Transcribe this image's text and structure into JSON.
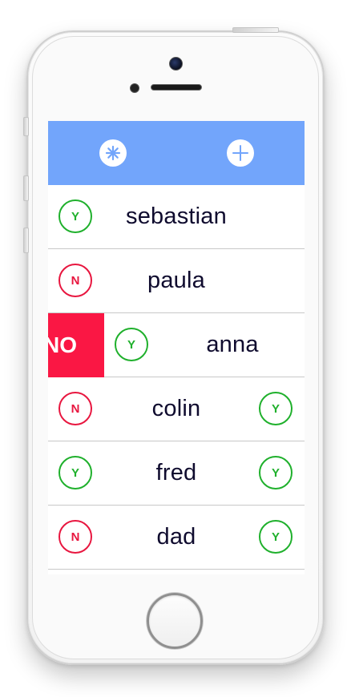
{
  "app": {
    "toolbar": {
      "settings_icon": "asterisk-icon",
      "add_icon": "plus-icon",
      "accent": "#72a5fb"
    },
    "people": [
      {
        "name": "sebastian",
        "left": "Y",
        "right": null,
        "swiped": false
      },
      {
        "name": "paula",
        "left": "N",
        "right": null,
        "swiped": false
      },
      {
        "name": "anna",
        "left": "Y",
        "right": null,
        "swiped": true,
        "action_label": "NO"
      },
      {
        "name": "colin",
        "left": "N",
        "right": "Y",
        "swiped": false
      },
      {
        "name": "fred",
        "left": "Y",
        "right": "Y",
        "swiped": false
      },
      {
        "name": "dad",
        "left": "N",
        "right": "Y",
        "swiped": false
      }
    ],
    "colors": {
      "yes": "#1fb02c",
      "no": "#e8163f",
      "swipe_action": "#fa1744",
      "text": "#0f0b2e"
    }
  }
}
